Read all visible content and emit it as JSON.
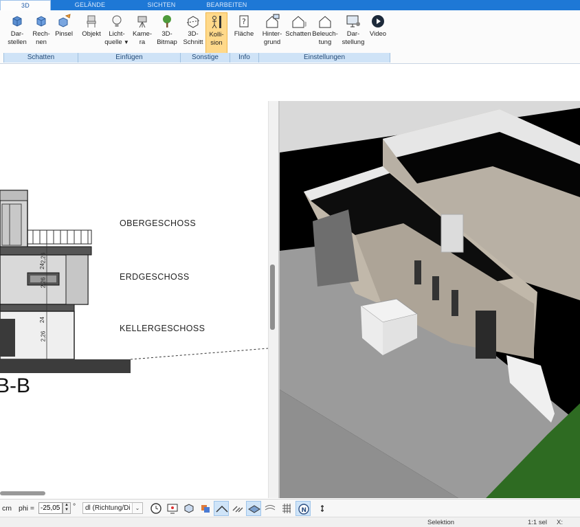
{
  "tabs": [
    {
      "label": "3D",
      "active": true
    },
    {
      "label": "GELÄNDE",
      "active": false
    },
    {
      "label": "SICHTEN",
      "active": false
    },
    {
      "label": "BEARBEITEN",
      "active": false
    }
  ],
  "ribbon": {
    "buttons": {
      "darstellen": [
        "Dar-",
        "stellen"
      ],
      "rechnen": [
        "Rech-",
        "nen"
      ],
      "pinsel": "Pinsel",
      "objekt": "Objekt",
      "lichtquelle": [
        "Licht-",
        "quelle"
      ],
      "kamera": [
        "Kame-",
        "ra"
      ],
      "bitmap3d": [
        "3D-",
        "Bitmap"
      ],
      "schnitt3d": [
        "3D-",
        "Schnitt"
      ],
      "kollision": [
        "Kolli-",
        "sion"
      ],
      "flaeche": "Fläche",
      "hintergrund": [
        "Hinter-",
        "grund"
      ],
      "schatten": "Schatten",
      "beleuchtung": [
        "Beleuch-",
        "tung"
      ],
      "darstellung": [
        "Dar-",
        "stellung"
      ],
      "video": "Video"
    },
    "groups": {
      "schatten": "Schatten",
      "einfuegen": "Einfügen",
      "sonstige": "Sonstige",
      "info": "Info",
      "einstellungen": "Einstellungen"
    },
    "active_button": "Kollision"
  },
  "drawing": {
    "labels": {
      "obergeschoss": "OBERGESCHOSS",
      "erdgeschoss": "ERDGESCHOSS",
      "kellergeschoss": "KELLERGESCHOSS"
    },
    "section_title": "B-B",
    "dimensions": [
      "2,26",
      "24",
      "2,26",
      "24",
      "2,26"
    ]
  },
  "bottom_toolbar": {
    "unit": "cm",
    "phi_label": "phi =",
    "phi_value": "-25,05",
    "degree": "°",
    "direction_select": "dl (Richtung/Di",
    "tool_icons": [
      "clock-icon",
      "monitor-icon",
      "render-icon",
      "layers-icon",
      "roof-icon",
      "hatch-icon",
      "plane-icon",
      "surface-icon",
      "grid-icon",
      "north-icon",
      "more-icon"
    ]
  },
  "status": {
    "mode": "Selektion",
    "scale": "1:1 sel",
    "x_label": "X:"
  },
  "colors": {
    "tab_bar": "#1e78d6",
    "group_bar": "#cfe3f7",
    "active_button": "#ffd98a",
    "grass": "#2e6b22",
    "pavement": "#9a9a9a"
  }
}
